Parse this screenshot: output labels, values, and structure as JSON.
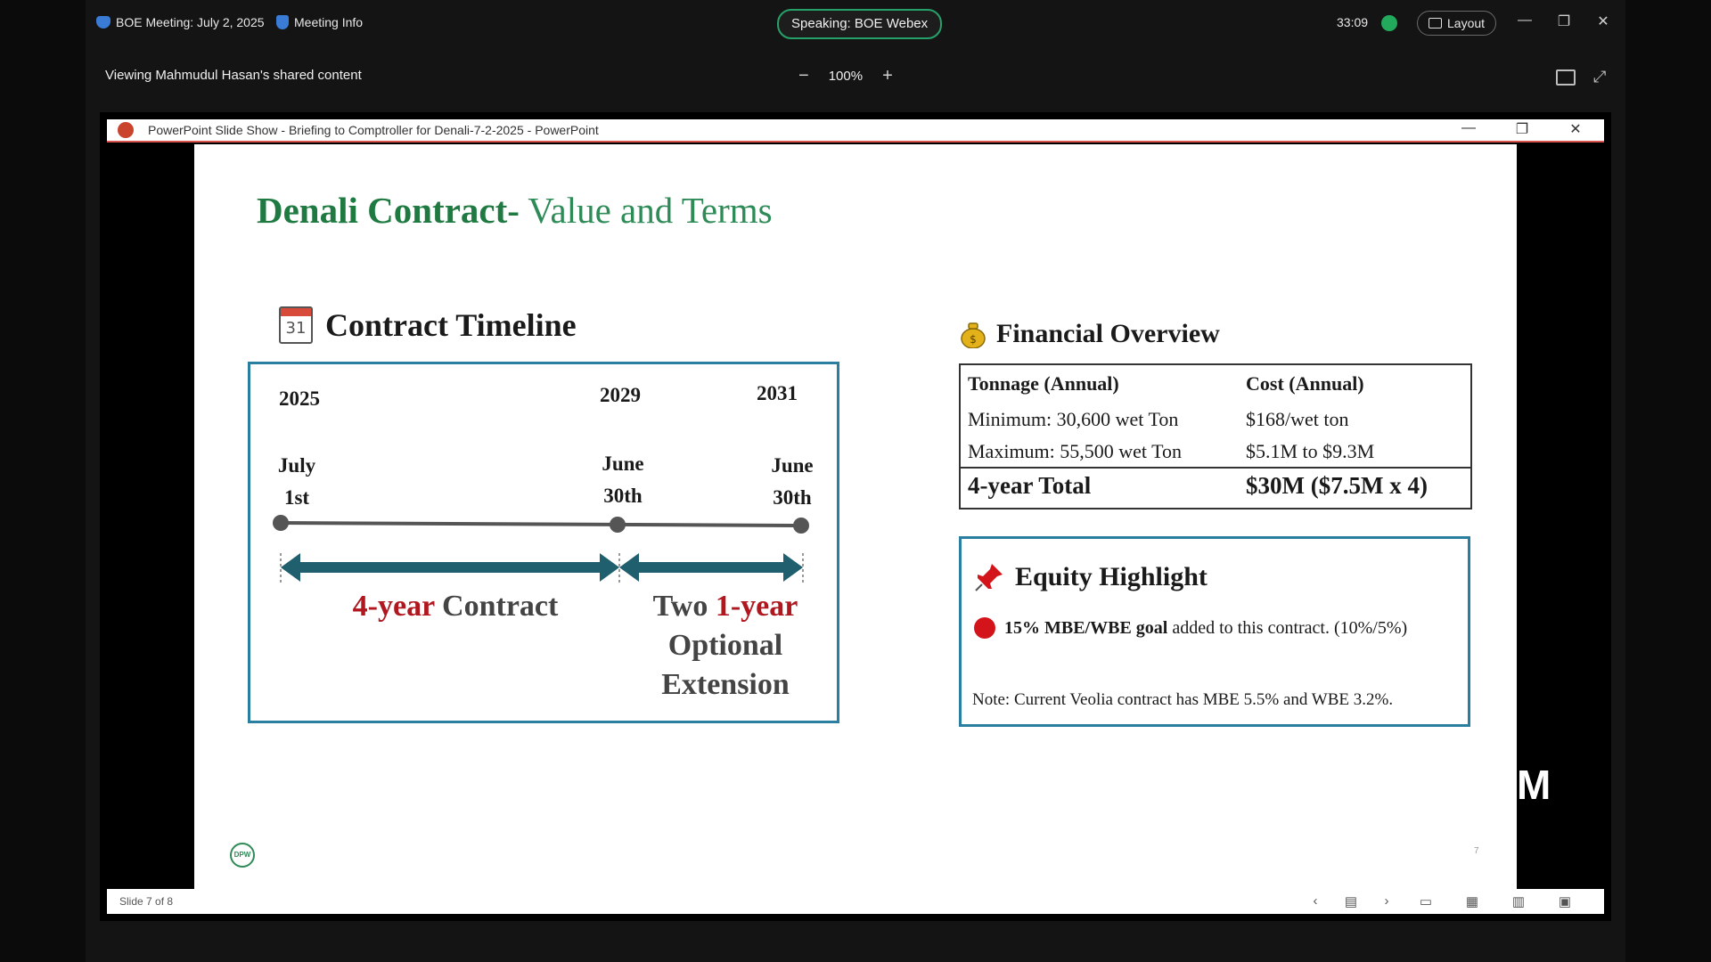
{
  "webex": {
    "meeting_title": "BOE Meeting: July 2, 2025",
    "meeting_info": "Meeting Info",
    "speaking": "Speaking: BOE Webex",
    "timer": "33:09",
    "layout_label": "Layout",
    "viewing": "Viewing Mahmudul Hasan's shared content",
    "zoom_level": "100%",
    "zoom_out": "−",
    "zoom_in": "+"
  },
  "ppt": {
    "window_title": "PowerPoint Slide Show  -  Briefing to Comptroller for Denali-7-2-2025 - PowerPoint",
    "status": "Slide 7 of 8",
    "page_number": "7"
  },
  "slide": {
    "title_bold": "Denali Contract-",
    "title_rest": " Value and Terms",
    "timeline": {
      "heading": "Contract Timeline",
      "calendar_number": "31",
      "years": [
        "2025",
        "2029",
        "2031"
      ],
      "dates": [
        {
          "month": "July",
          "day": "1st"
        },
        {
          "month": "June",
          "day": "30th"
        },
        {
          "month": "June",
          "day": "30th"
        }
      ],
      "contract_red": "4-year",
      "contract_rest": " Contract",
      "ext_line1_a": "Two ",
      "ext_line1_b": "1-year",
      "ext_line2": "Optional",
      "ext_line3": "Extension"
    },
    "financial": {
      "heading": "Financial Overview",
      "col1_header": "Tonnage (Annual)",
      "col2_header": "Cost (Annual)",
      "row1_c1": "Minimum: 30,600 wet Ton",
      "row1_c2": "$168/wet ton",
      "row2_c1": "Maximum: 55,500 wet Ton",
      "row2_c2": "$5.1M to $9.3M",
      "total_label": "4-year Total",
      "total_value": "$30M ($7.5M x 4)"
    },
    "equity": {
      "heading": "Equity Highlight",
      "goal_bold": "15% MBE/WBE goal",
      "goal_rest": " added to this contract. (10%/5%)",
      "note": "Note: Current Veolia contract has MBE 5.5% and WBE 3.2%."
    },
    "logo_text": "DPW",
    "overlay_text": "M"
  },
  "colors": {
    "title_green": "#1f7a42",
    "accent_red": "#b0171f",
    "box_border": "#2a7fa0",
    "arrow": "#1f5f6e",
    "speaking_border": "#27a16a"
  }
}
